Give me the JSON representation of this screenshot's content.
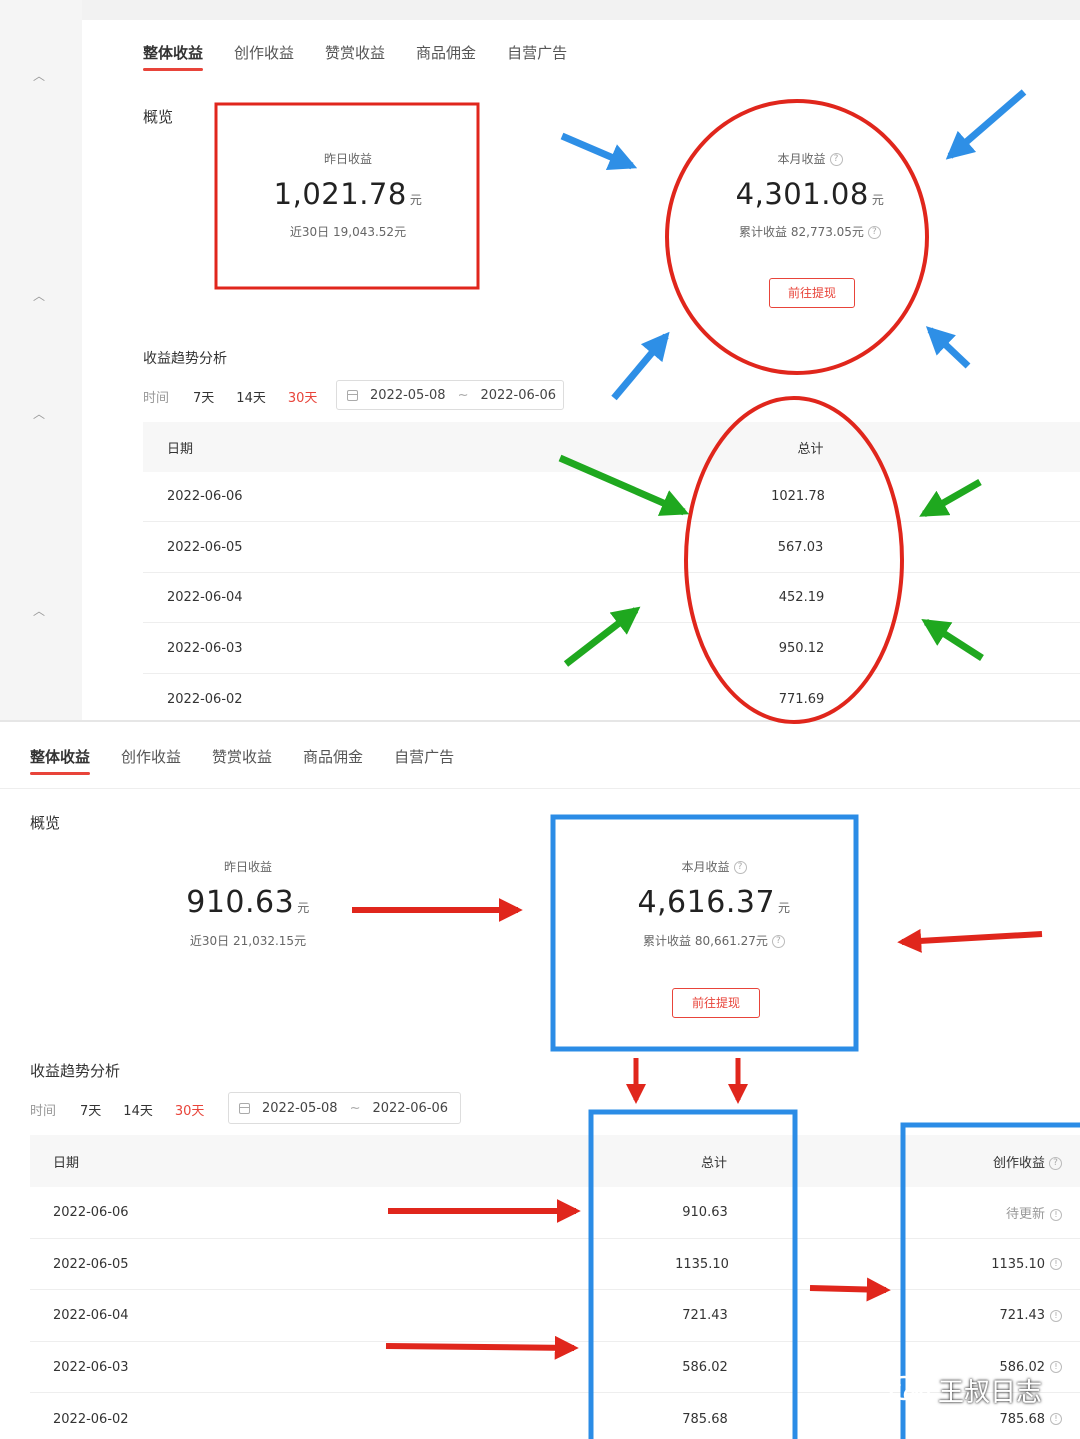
{
  "tabs": [
    "整体收益",
    "创作收益",
    "赞赏收益",
    "商品佣金",
    "自营广告"
  ],
  "overview_title": "概览",
  "trend_title": "收益趋势分析",
  "filter": {
    "time_label": "时间",
    "options": [
      "7天",
      "14天",
      "30天"
    ],
    "active": "30天",
    "date_start": "2022-05-08",
    "date_sep": "~",
    "date_end": "2022-06-06"
  },
  "labels": {
    "yesterday": "昨日收益",
    "this_month": "本月收益",
    "unit": "元",
    "withdraw": "前往提现",
    "col_date": "日期",
    "col_total": "总计",
    "col_creation": "创作收益",
    "help_icon": "question-circle-icon"
  },
  "panel1": {
    "yesterday_value": "1,021.78",
    "last30": "近30日 19,043.52元",
    "month_value": "4,301.08",
    "cumulative": "累计收益 82,773.05元",
    "rows": [
      {
        "date": "2022-06-06",
        "total": "1021.78"
      },
      {
        "date": "2022-06-05",
        "total": "567.03"
      },
      {
        "date": "2022-06-04",
        "total": "452.19"
      },
      {
        "date": "2022-06-03",
        "total": "950.12"
      },
      {
        "date": "2022-06-02",
        "total": "771.69"
      }
    ]
  },
  "panel2": {
    "yesterday_value": "910.63",
    "last30": "近30日 21,032.15元",
    "month_value": "4,616.37",
    "cumulative": "累计收益 80,661.27元",
    "rows": [
      {
        "date": "2022-06-06",
        "total": "910.63",
        "creation": "待更新"
      },
      {
        "date": "2022-06-05",
        "total": "1135.10",
        "creation": "1135.10"
      },
      {
        "date": "2022-06-04",
        "total": "721.43",
        "creation": "721.43"
      },
      {
        "date": "2022-06-03",
        "total": "586.02",
        "creation": "586.02"
      },
      {
        "date": "2022-06-02",
        "total": "785.68",
        "creation": "785.68"
      }
    ]
  },
  "watermark": "王叔日志",
  "colors": {
    "accent_red": "#e8443a",
    "annotation_red": "#e0261c",
    "annotation_blue": "#2e8fe6",
    "annotation_green": "#1fa81f",
    "box_blue": "#2b8ce6"
  }
}
